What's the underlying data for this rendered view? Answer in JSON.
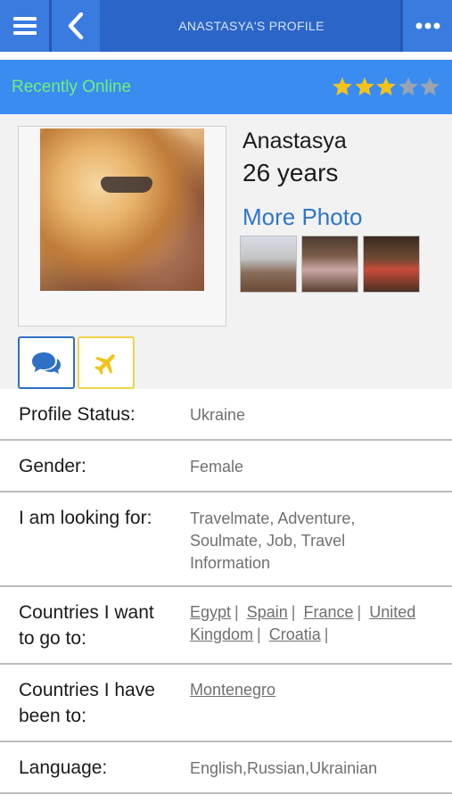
{
  "header": {
    "title": "ANASTASYA'S PROFILE"
  },
  "status": {
    "text": "Recently Online",
    "rating": 3,
    "rating_max": 5,
    "star_on_color": "#f4c21c",
    "star_off_color": "#9aa4b0"
  },
  "profile": {
    "name": "Anastasya",
    "age": "26 years",
    "more_photo": "More Photo"
  },
  "details": [
    {
      "label": "Profile Status:",
      "value": "Ukraine"
    },
    {
      "label": "Gender:",
      "value": "Female"
    },
    {
      "label": "I am looking for:",
      "value": "Travelmate, Adventure, Soulmate, Job, Travel Information"
    },
    {
      "label": "Countries I want to go to:",
      "links": [
        "Egypt",
        "Spain",
        "France",
        "United Kingdom",
        "Croatia"
      ]
    },
    {
      "label": "Countries I have been to:",
      "links": [
        "Montenegro"
      ]
    },
    {
      "label": "Language:",
      "value": "English,Russian,Ukrainian"
    }
  ],
  "colors": {
    "nav": "#2b65c7",
    "status_bar": "#3b8cf0",
    "online": "#6ff07a",
    "link": "#2f76c9"
  },
  "icons": {
    "menu": "hamburger-icon",
    "back": "chevron-left-icon",
    "more": "more-dots-icon",
    "chat": "chat-bubbles-icon",
    "travel": "airplane-icon"
  }
}
